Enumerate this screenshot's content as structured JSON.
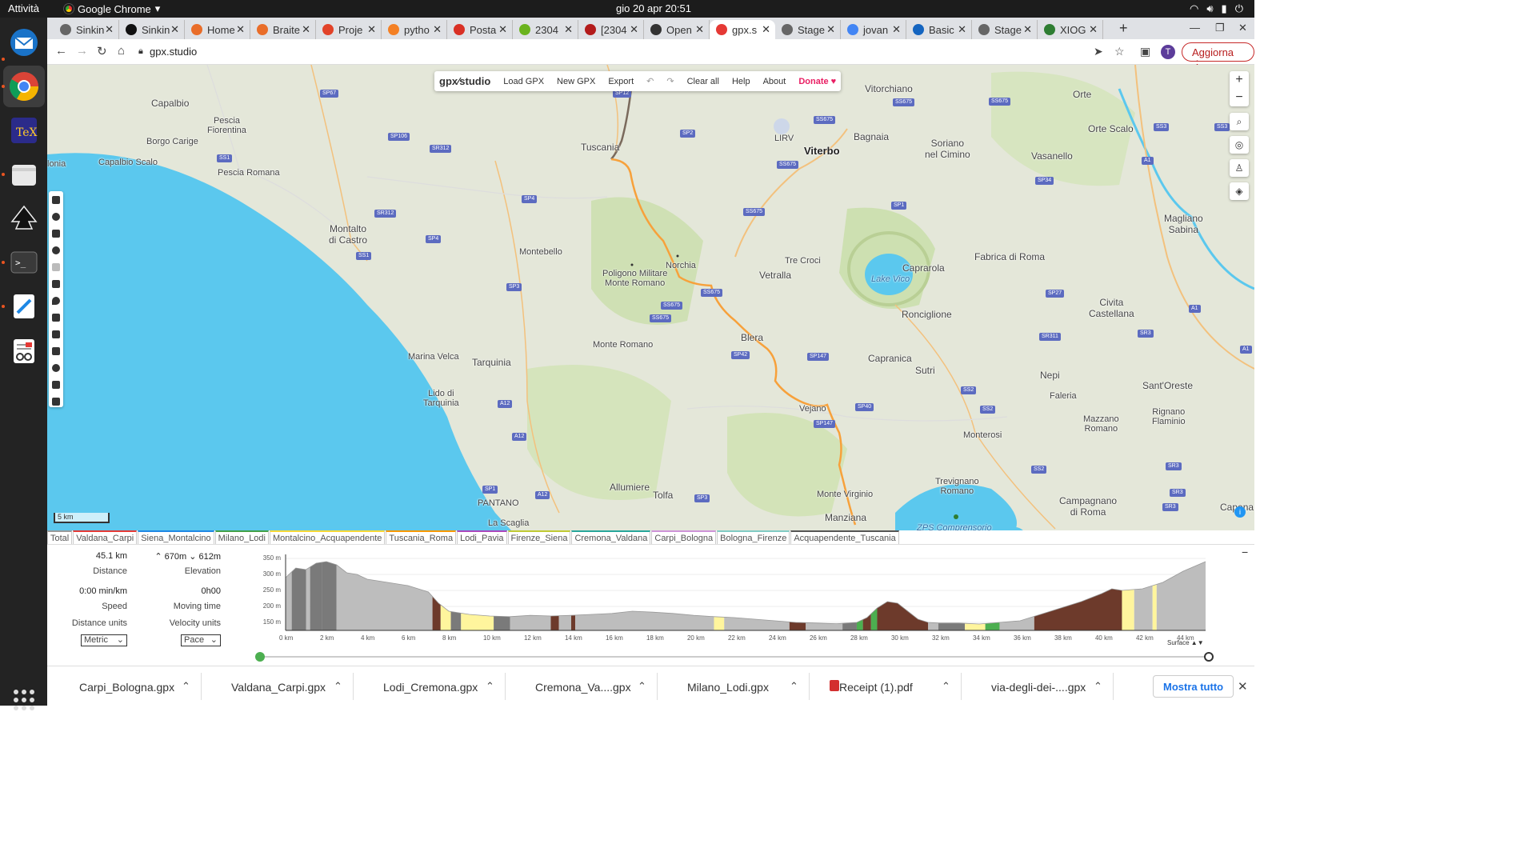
{
  "topbar": {
    "activities": "Attività",
    "app": "Google Chrome",
    "app_arrow": "▾",
    "clock": "gio 20 apr  20:51",
    "tray": [
      "wifi-icon",
      "volume-icon",
      "battery-icon",
      "power-icon"
    ]
  },
  "dock": {
    "items": [
      "thunderbird",
      "chrome",
      "texstudio",
      "files",
      "inkscape",
      "terminal",
      "text-editor",
      "document-viewer"
    ]
  },
  "browser": {
    "tabs": [
      {
        "label": "Sinkin",
        "color": "#666"
      },
      {
        "label": "Sinkin",
        "color": "#111"
      },
      {
        "label": "Home",
        "color": "#e96d29"
      },
      {
        "label": "Braite",
        "color": "#e96d29"
      },
      {
        "label": "Proje",
        "color": "#e24329"
      },
      {
        "label": "pytho",
        "color": "#f48024"
      },
      {
        "label": "Posta",
        "color": "#d93025"
      },
      {
        "label": "2304",
        "color": "#6bb31e"
      },
      {
        "label": "[2304",
        "color": "#b31b1b"
      },
      {
        "label": "Open",
        "color": "#333"
      },
      {
        "label": "gpx.s",
        "color": "#e53935"
      },
      {
        "label": "Stage",
        "color": "#666"
      },
      {
        "label": "jovan",
        "color": "#4285f4"
      },
      {
        "label": "Basic",
        "color": "#1565c0"
      },
      {
        "label": "Stage",
        "color": "#666"
      },
      {
        "label": "XIOG",
        "color": "#2e7d32"
      }
    ],
    "new_tab": "+",
    "url": "gpx.studio",
    "update_label": "Aggiorna",
    "avatar_letter": "T"
  },
  "gpx_menu": {
    "logo": "gpx⁄studio",
    "items": [
      "Load GPX",
      "New GPX",
      "Export",
      "↶",
      "↷",
      "Clear all",
      "Help",
      "About"
    ],
    "donate": "Donate ♥"
  },
  "map": {
    "zoom_in": "+",
    "zoom_out": "−",
    "scale": "5 km",
    "places": [
      {
        "name": "Capalbio",
        "x": 130,
        "y": 41,
        "cls": "med"
      },
      {
        "name": "Pescia\nFiorentina",
        "x": 200,
        "y": 64
      },
      {
        "name": "Borgo Carige",
        "x": 124,
        "y": 90
      },
      {
        "name": "Capalbio Scalo",
        "x": 64,
        "y": 116
      },
      {
        "name": "Pescia Romana",
        "x": 213,
        "y": 129
      },
      {
        "name": "Montalto\ndi Castro",
        "x": 352,
        "y": 198,
        "cls": "med"
      },
      {
        "name": "Montebello",
        "x": 590,
        "y": 228
      },
      {
        "name": "Tuscania",
        "x": 667,
        "y": 96,
        "cls": "med"
      },
      {
        "name": "Poligono Militare\nMonte Romano",
        "x": 694,
        "y": 255
      },
      {
        "name": "Norchia",
        "x": 773,
        "y": 245
      },
      {
        "name": "Monte Romano",
        "x": 682,
        "y": 344
      },
      {
        "name": "Marina Velca",
        "x": 451,
        "y": 359
      },
      {
        "name": "Tarquinia",
        "x": 531,
        "y": 365,
        "cls": "med"
      },
      {
        "name": "Lido di\nTarquinia",
        "x": 470,
        "y": 405
      },
      {
        "name": "Allumiere",
        "x": 703,
        "y": 521,
        "cls": "med"
      },
      {
        "name": "Tolfa",
        "x": 757,
        "y": 531,
        "cls": "med"
      },
      {
        "name": "PANTANO",
        "x": 538,
        "y": 542
      },
      {
        "name": "La Scaglia",
        "x": 551,
        "y": 567
      },
      {
        "name": "Viterbo",
        "x": 946,
        "y": 100,
        "cls": "big"
      },
      {
        "name": "Bagnaia",
        "x": 1008,
        "y": 83,
        "cls": "med"
      },
      {
        "name": "Vitorchiano",
        "x": 1022,
        "y": 23,
        "cls": "med"
      },
      {
        "name": "LIRV",
        "x": 909,
        "y": 86
      },
      {
        "name": "Vetralla",
        "x": 890,
        "y": 256,
        "cls": "med"
      },
      {
        "name": "Tre Croci",
        "x": 922,
        "y": 239
      },
      {
        "name": "Blera",
        "x": 867,
        "y": 334,
        "cls": "med"
      },
      {
        "name": "Vejano",
        "x": 940,
        "y": 424
      },
      {
        "name": "Monte Virginio",
        "x": 962,
        "y": 531
      },
      {
        "name": "Manziana",
        "x": 972,
        "y": 559,
        "cls": "med"
      },
      {
        "name": "Lake Vico",
        "x": 1030,
        "y": 262,
        "cls": "water"
      },
      {
        "name": "Caprarola",
        "x": 1069,
        "y": 247,
        "cls": "med"
      },
      {
        "name": "Ronciglione",
        "x": 1068,
        "y": 305,
        "cls": "med"
      },
      {
        "name": "Capranica",
        "x": 1026,
        "y": 360,
        "cls": "med"
      },
      {
        "name": "Sutri",
        "x": 1085,
        "y": 375,
        "cls": "med"
      },
      {
        "name": "Soriano\nnel Cimino",
        "x": 1097,
        "y": 91,
        "cls": "med"
      },
      {
        "name": "Vasanello",
        "x": 1230,
        "y": 107,
        "cls": "med"
      },
      {
        "name": "Orte",
        "x": 1282,
        "y": 30,
        "cls": "med"
      },
      {
        "name": "Orte Scalo",
        "x": 1301,
        "y": 73,
        "cls": "med"
      },
      {
        "name": "Fabrica di Roma",
        "x": 1159,
        "y": 233,
        "cls": "med"
      },
      {
        "name": "Magliano\nSabina",
        "x": 1396,
        "y": 185,
        "cls": "med"
      },
      {
        "name": "Civita\nCastellana",
        "x": 1302,
        "y": 290,
        "cls": "med"
      },
      {
        "name": "Nepi",
        "x": 1241,
        "y": 381,
        "cls": "med"
      },
      {
        "name": "Faleria",
        "x": 1253,
        "y": 408
      },
      {
        "name": "Sant'Oreste",
        "x": 1369,
        "y": 394,
        "cls": "med"
      },
      {
        "name": "Rignano\nFlaminio",
        "x": 1381,
        "y": 428
      },
      {
        "name": "Mazzano\nRomano",
        "x": 1295,
        "y": 437
      },
      {
        "name": "Monterosi",
        "x": 1145,
        "y": 457
      },
      {
        "name": "Trevignano\nRomano",
        "x": 1110,
        "y": 515
      },
      {
        "name": "Campagnano\ndi Roma",
        "x": 1265,
        "y": 538,
        "cls": "med"
      },
      {
        "name": "ZPS Comprensorio\nBracciano-Martignano",
        "x": 1080,
        "y": 573,
        "cls": "water"
      },
      {
        "name": "Capena",
        "x": 1466,
        "y": 546,
        "cls": "med"
      },
      {
        "name": "lonia",
        "x": 0,
        "y": 118
      }
    ],
    "roads": [
      {
        "name": "SP67",
        "x": 341,
        "y": 31
      },
      {
        "name": "SP106",
        "x": 426,
        "y": 85
      },
      {
        "name": "SR312",
        "x": 478,
        "y": 100
      },
      {
        "name": "SS1",
        "x": 212,
        "y": 112
      },
      {
        "name": "SR312",
        "x": 409,
        "y": 181
      },
      {
        "name": "SP4",
        "x": 593,
        "y": 163
      },
      {
        "name": "SP4",
        "x": 473,
        "y": 213
      },
      {
        "name": "SS1",
        "x": 386,
        "y": 234
      },
      {
        "name": "SP3",
        "x": 574,
        "y": 273
      },
      {
        "name": "SP12",
        "x": 707,
        "y": 31
      },
      {
        "name": "SP2",
        "x": 791,
        "y": 81
      },
      {
        "name": "SS675",
        "x": 958,
        "y": 64
      },
      {
        "name": "SS675",
        "x": 1057,
        "y": 42
      },
      {
        "name": "SS675",
        "x": 1177,
        "y": 41
      },
      {
        "name": "SS675",
        "x": 912,
        "y": 120
      },
      {
        "name": "SS675",
        "x": 870,
        "y": 179
      },
      {
        "name": "SP1",
        "x": 1055,
        "y": 171
      },
      {
        "name": "SS675",
        "x": 767,
        "y": 296
      },
      {
        "name": "SS675",
        "x": 753,
        "y": 312
      },
      {
        "name": "SS675",
        "x": 817,
        "y": 280
      },
      {
        "name": "SP42",
        "x": 855,
        "y": 358
      },
      {
        "name": "SP147",
        "x": 950,
        "y": 360
      },
      {
        "name": "SP147",
        "x": 958,
        "y": 444
      },
      {
        "name": "SP40",
        "x": 1010,
        "y": 423
      },
      {
        "name": "A12",
        "x": 563,
        "y": 419
      },
      {
        "name": "A12",
        "x": 581,
        "y": 460
      },
      {
        "name": "A12",
        "x": 610,
        "y": 533
      },
      {
        "name": "SP1",
        "x": 544,
        "y": 526
      },
      {
        "name": "SP3",
        "x": 809,
        "y": 537
      },
      {
        "name": "SS2",
        "x": 1142,
        "y": 402
      },
      {
        "name": "SS2",
        "x": 1166,
        "y": 426
      },
      {
        "name": "SS2",
        "x": 1230,
        "y": 501
      },
      {
        "name": "SS2",
        "x": 1266,
        "y": 589
      },
      {
        "name": "SP27",
        "x": 1248,
        "y": 281
      },
      {
        "name": "SR311",
        "x": 1240,
        "y": 335
      },
      {
        "name": "SR3",
        "x": 1363,
        "y": 331
      },
      {
        "name": "SP34",
        "x": 1235,
        "y": 140
      },
      {
        "name": "SS3",
        "x": 1383,
        "y": 73
      },
      {
        "name": "A1",
        "x": 1368,
        "y": 115
      },
      {
        "name": "A1",
        "x": 1427,
        "y": 300
      },
      {
        "name": "A1",
        "x": 1491,
        "y": 351
      },
      {
        "name": "SR3",
        "x": 1398,
        "y": 497
      },
      {
        "name": "SR3",
        "x": 1403,
        "y": 530
      },
      {
        "name": "SR3",
        "x": 1394,
        "y": 548
      },
      {
        "name": "SS3",
        "x": 1459,
        "y": 73
      }
    ]
  },
  "track_tabs": [
    {
      "label": "Total",
      "color": "#999"
    },
    {
      "label": "Valdana_Carpi",
      "color": "#e53935"
    },
    {
      "label": "Siena_Montalcino",
      "color": "#1e88e5"
    },
    {
      "label": "Milano_Lodi",
      "color": "#43a047"
    },
    {
      "label": "Montalcino_Acquapendente",
      "color": "#fdd835"
    },
    {
      "label": "Tuscania_Roma",
      "color": "#ff9800"
    },
    {
      "label": "Lodi_Pavia",
      "color": "#ab47bc"
    },
    {
      "label": "Firenze_Siena",
      "color": "#c0ca33"
    },
    {
      "label": "Cremona_Valdana",
      "color": "#26a69a"
    },
    {
      "label": "Carpi_Bologna",
      "color": "#ce93d8"
    },
    {
      "label": "Bologna_Firenze",
      "color": "#80cbc4"
    },
    {
      "label": "Acquapendente_Tuscania",
      "color": "#555"
    }
  ],
  "stats": {
    "distance_value": "45.1 km",
    "distance_label": "Distance",
    "elevation_value": "670m ⌄ 612m",
    "elevation_up_arrow": "⌃",
    "elevation_label": "Elevation",
    "speed_value": "0:00 min/km",
    "speed_label": "Speed",
    "moving_value": "0h00",
    "moving_label": "Moving time",
    "distance_units_label": "Distance units",
    "velocity_units_label": "Velocity units",
    "distance_units_value": "Metric",
    "velocity_units_value": "Pace"
  },
  "elevation_chart": {
    "y_ticks": [
      "350 m",
      "300 m",
      "250 m",
      "200 m",
      "150 m"
    ],
    "x_ticks": [
      "0 km",
      "2 km",
      "4 km",
      "6 km",
      "8 km",
      "10 km",
      "12 km",
      "14 km",
      "16 km",
      "18 km",
      "20 km",
      "22 km",
      "24 km",
      "26 km",
      "28 km",
      "30 km",
      "32 km",
      "34 km",
      "36 km",
      "38 km",
      "40 km",
      "42 km",
      "44 km"
    ],
    "surface_label": "Surface ▲▼",
    "collapse": "−"
  },
  "chart_data": {
    "type": "area",
    "title": "",
    "xlabel": "",
    "ylabel": "",
    "xlim": [
      0,
      45.1
    ],
    "ylim": [
      125,
      350
    ],
    "x": [
      0,
      0.5,
      1,
      1.5,
      2,
      2.5,
      3,
      3.5,
      4,
      5,
      6,
      7,
      7.5,
      8,
      9,
      10,
      11,
      12,
      13,
      14,
      15,
      16,
      17,
      18,
      19,
      20,
      21,
      22,
      23,
      24,
      25,
      26,
      27,
      28,
      28.5,
      29,
      29.5,
      30,
      30.5,
      31,
      31.5,
      32,
      33,
      34,
      35,
      36,
      37,
      38,
      39,
      40,
      40.5,
      41,
      42,
      43,
      44,
      45.1
    ],
    "series": [
      {
        "values": [
          290,
          320,
          315,
          335,
          340,
          330,
          305,
          300,
          285,
          275,
          265,
          245,
          210,
          185,
          175,
          170,
          168,
          172,
          170,
          172,
          175,
          178,
          185,
          182,
          178,
          172,
          168,
          165,
          160,
          155,
          150,
          148,
          146,
          150,
          165,
          195,
          215,
          210,
          185,
          160,
          150,
          148,
          148,
          145,
          150,
          155,
          175,
          195,
          215,
          240,
          255,
          250,
          255,
          275,
          310,
          340
        ]
      }
    ],
    "surface_colors": {
      "unpaved": "#6d3a2b",
      "gravel": "#fff59d",
      "paved": "#bdbdbd",
      "asphalt": "#7a7a7a",
      "grass": "#4caf50"
    }
  },
  "downloads": {
    "items": [
      "Carpi_Bologna.gpx",
      "Valdana_Carpi.gpx",
      "Lodi_Cremona.gpx",
      "Cremona_Va....gpx",
      "Milano_Lodi.gpx",
      "Receipt (1).pdf",
      "via-degli-dei-....gpx"
    ],
    "chevron": "⌃",
    "show_all": "Mostra tutto",
    "close": "✕"
  }
}
